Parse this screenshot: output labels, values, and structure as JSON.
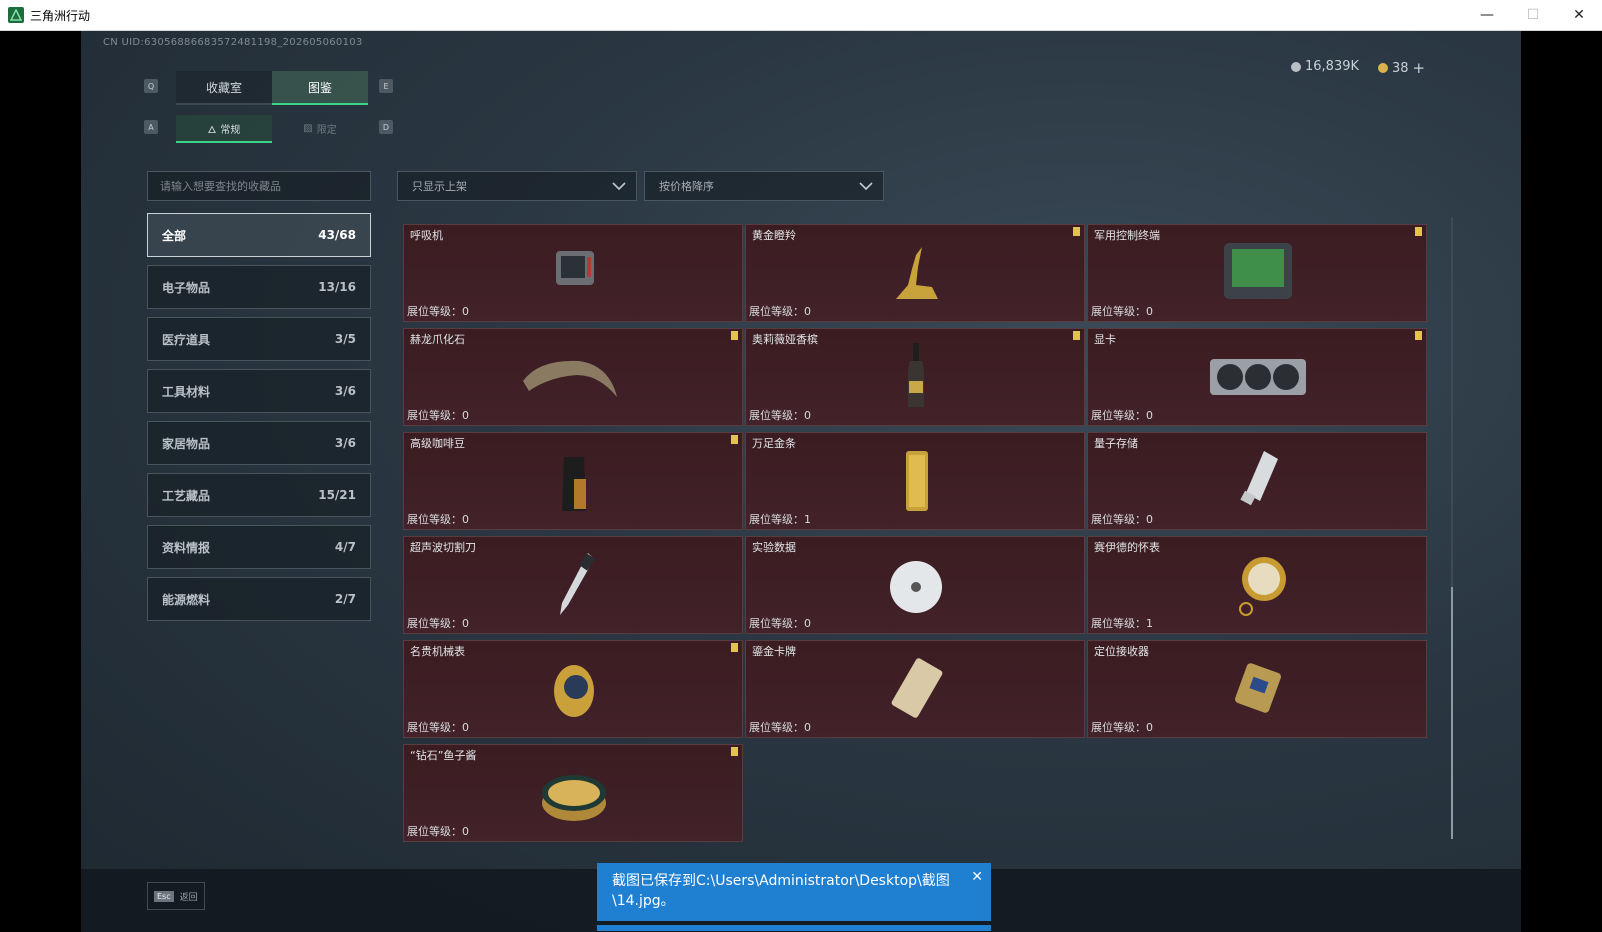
{
  "window": {
    "title": "三角洲行动",
    "minimize": "—",
    "maximize": "☐",
    "close": "✕"
  },
  "uid": "CN UID:6305688668357248​1198_202605060103",
  "currency": {
    "coins": "16,839K",
    "tickets": "38",
    "plus": "+"
  },
  "keys": {
    "tab_left": "Q",
    "tab_right": "E",
    "sub_left": "A",
    "sub_right": "D"
  },
  "tabs": [
    {
      "label": "收藏室",
      "active": false
    },
    {
      "label": "图鉴",
      "active": true
    }
  ],
  "subtabs": [
    {
      "label": "常规",
      "active": true
    },
    {
      "label": "限定",
      "active": false
    }
  ],
  "search": {
    "placeholder": "请输入想要查找的收藏品"
  },
  "filters": [
    {
      "label": "只显示上架"
    },
    {
      "label": "按价格降序"
    }
  ],
  "categories": [
    {
      "label": "全部",
      "count": "43/68",
      "active": true
    },
    {
      "label": "电子物品",
      "count": "13/16"
    },
    {
      "label": "医疗道具",
      "count": "3/5"
    },
    {
      "label": "工具材料",
      "count": "3/6"
    },
    {
      "label": "家居物品",
      "count": "3/6"
    },
    {
      "label": "工艺藏品",
      "count": "15/21"
    },
    {
      "label": "资料情报",
      "count": "4/7"
    },
    {
      "label": "能源燃料",
      "count": "2/7"
    }
  ],
  "level_prefix": "展位等级：",
  "items": [
    {
      "name": "呼吸机",
      "level": "0",
      "badge": false,
      "icon": "ventilator-icon"
    },
    {
      "name": "黄金瞪羚",
      "level": "0",
      "badge": true,
      "icon": "golden-gazelle-icon"
    },
    {
      "name": "军用控制终端",
      "level": "0",
      "badge": true,
      "icon": "military-terminal-icon"
    },
    {
      "name": "赫龙爪化石",
      "level": "0",
      "badge": true,
      "icon": "claw-fossil-icon"
    },
    {
      "name": "奥莉薇娅香槟",
      "level": "0",
      "badge": true,
      "icon": "champagne-icon"
    },
    {
      "name": "显卡",
      "level": "0",
      "badge": true,
      "icon": "graphics-card-icon"
    },
    {
      "name": "高级咖啡豆",
      "level": "0",
      "badge": true,
      "icon": "coffee-beans-icon"
    },
    {
      "name": "万足金条",
      "level": "1",
      "badge": false,
      "icon": "gold-bar-icon"
    },
    {
      "name": "量子存储",
      "level": "0",
      "badge": false,
      "icon": "quantum-storage-icon"
    },
    {
      "name": "超声波切割刀",
      "level": "0",
      "badge": false,
      "icon": "ultrasonic-cutter-icon"
    },
    {
      "name": "实验数据",
      "level": "0",
      "badge": false,
      "icon": "data-disc-icon"
    },
    {
      "name": "赛伊德的怀表",
      "level": "1",
      "badge": false,
      "icon": "pocket-watch-icon"
    },
    {
      "name": "名贵机械表",
      "level": "0",
      "badge": true,
      "icon": "luxury-watch-icon"
    },
    {
      "name": "鎏金卡牌",
      "level": "0",
      "badge": false,
      "icon": "gilded-card-icon"
    },
    {
      "name": "定位接收器",
      "level": "0",
      "badge": false,
      "icon": "gps-receiver-icon"
    },
    {
      "name": "“钻石”鱼子酱",
      "level": "0",
      "badge": true,
      "icon": "caviar-tin-icon"
    }
  ],
  "footer": {
    "esc_key": "Esc",
    "back_label": "返回"
  },
  "toast": {
    "message": "截图已保存到C:\\Users\\Administrator\\Desktop\\截图\\14.jpg。",
    "close": "✕"
  },
  "colors": {
    "accent_green": "#3bd28a",
    "card_bg": "#3a1c21",
    "badge": "#e3c34d",
    "toast_bg": "#1f7fd1"
  }
}
